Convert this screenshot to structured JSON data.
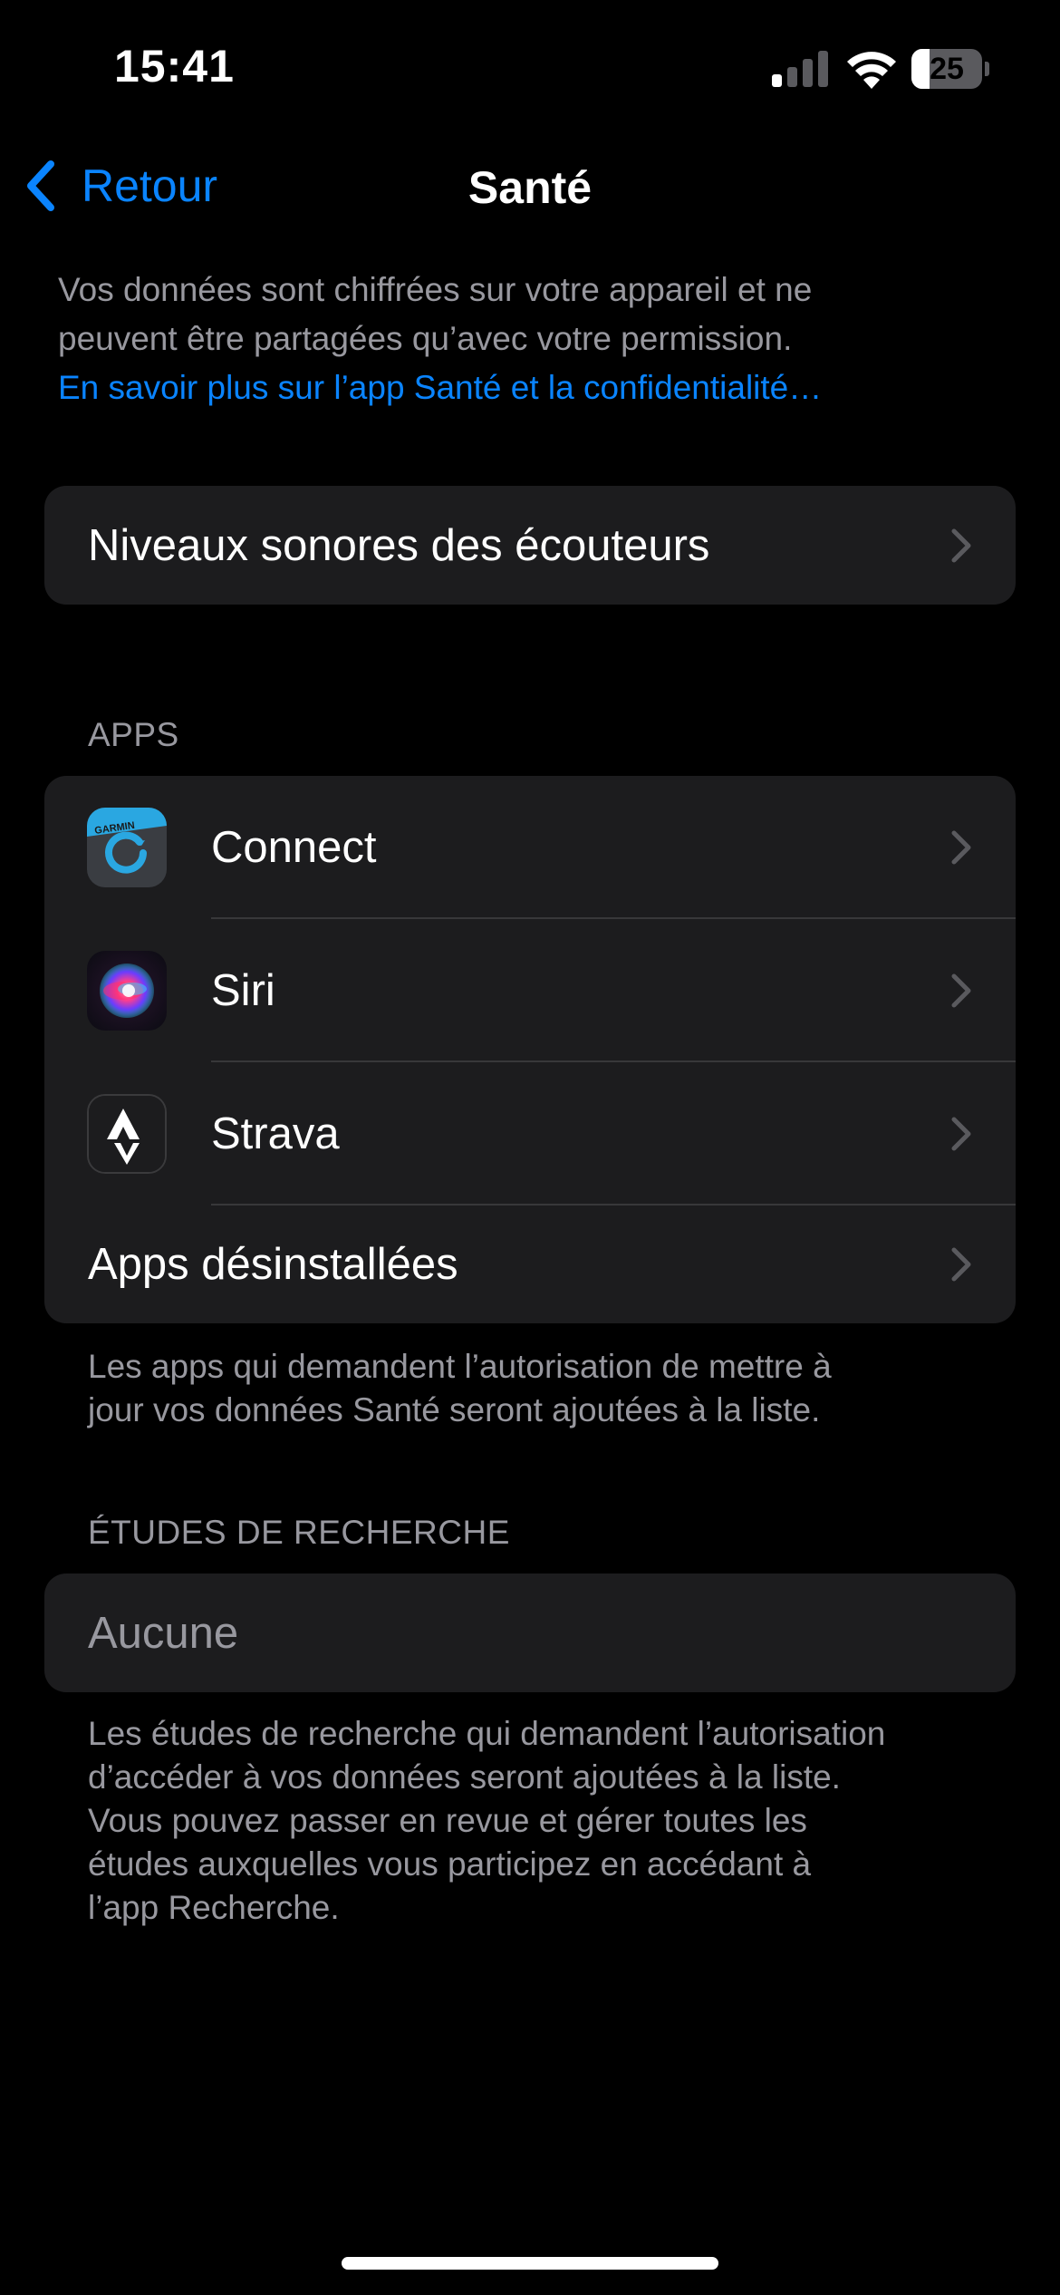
{
  "status_bar": {
    "time": "15:41",
    "battery_level": "25",
    "battery_fraction": 0.25,
    "signal_bars_active": 1,
    "signal_bars_total": 4
  },
  "nav": {
    "back_label": "Retour",
    "title": "Santé"
  },
  "intro": {
    "line1": "Vos données sont chiffrées sur votre appareil et ne",
    "line2": "peuvent être partagées qu’avec votre permission.",
    "link": "En savoir plus sur l’app Santé et la confidentialité…"
  },
  "headphone_row": {
    "label": "Niveaux sonores des écouteurs"
  },
  "apps_section": {
    "header": "APPS",
    "items": [
      {
        "label": "Connect",
        "icon": "garmin-connect-icon"
      },
      {
        "label": "Siri",
        "icon": "siri-icon"
      },
      {
        "label": "Strava",
        "icon": "strava-icon"
      },
      {
        "label": "Apps désinstallées"
      }
    ],
    "footer_line1": "Les apps qui demandent l’autorisation de mettre à",
    "footer_line2": "jour vos données Santé seront ajoutées à la liste."
  },
  "research_section": {
    "header": "ÉTUDES DE RECHERCHE",
    "empty_label": "Aucune",
    "footer_lines": [
      "Les études de recherche qui demandent l’autorisation",
      "d’accéder à vos données seront ajoutées à la liste.",
      "Vous pouvez passer en revue et gérer toutes les",
      "études auxquelles vous participez en accédant à",
      "l’app Recherche."
    ]
  },
  "garmin_badge": "GARMIN",
  "colors": {
    "background": "#000000",
    "group_background": "#1c1c1e",
    "accent": "#0a84ff",
    "secondary_text": "#98989f",
    "separator": "#38383a"
  }
}
